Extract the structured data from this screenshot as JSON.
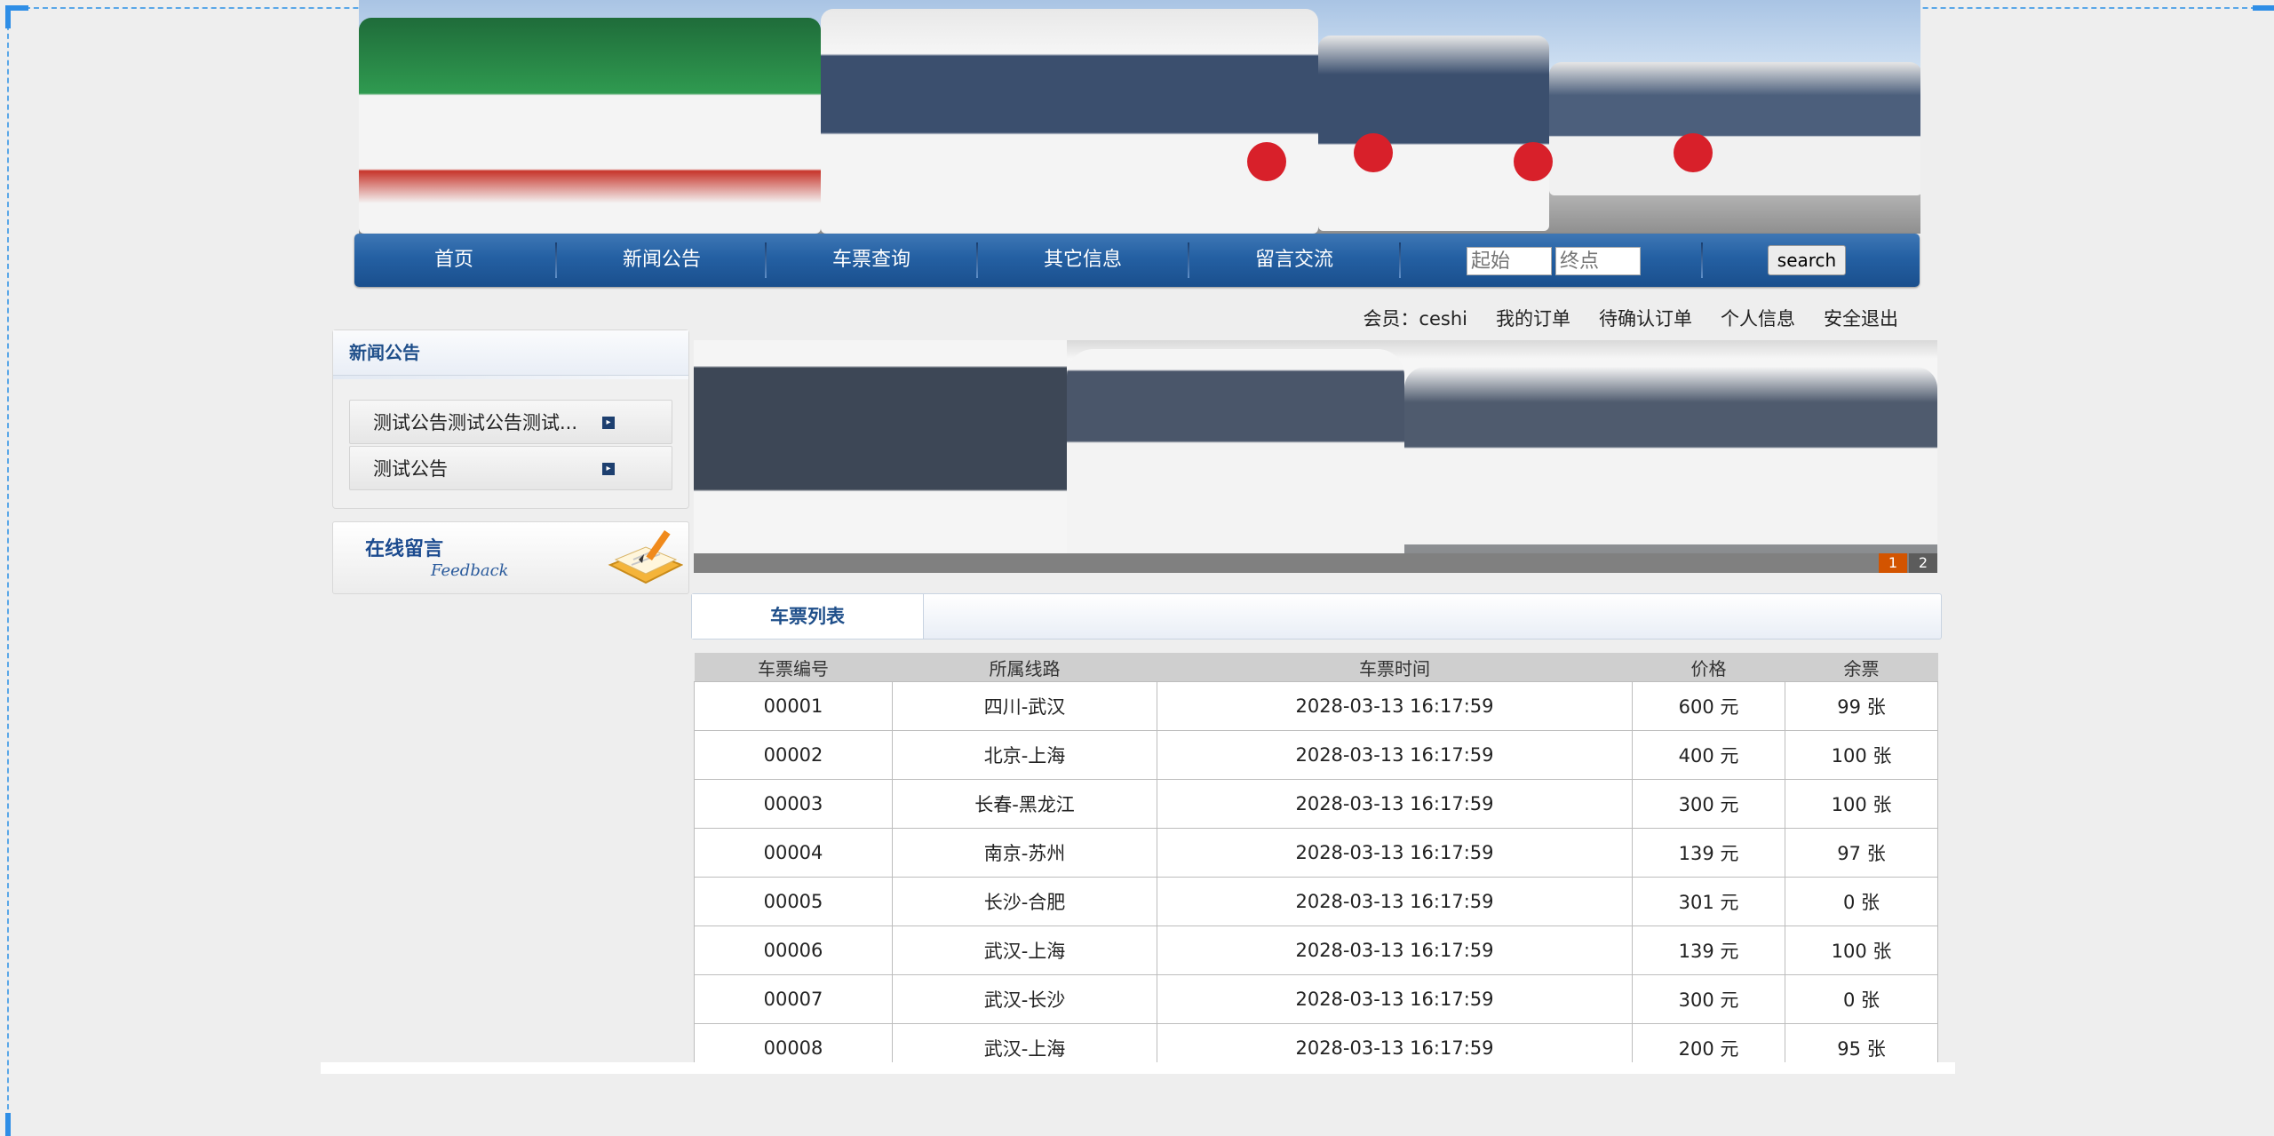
{
  "nav": {
    "items": [
      "首页",
      "新闻公告",
      "车票查询",
      "其它信息",
      "留言交流"
    ],
    "start_placeholder": "起始",
    "end_placeholder": "终点",
    "search_label": "search"
  },
  "member": {
    "label": "会员：ceshi",
    "links": [
      "我的订单",
      "待确认订单",
      "个人信息",
      "安全退出"
    ]
  },
  "news": {
    "title": "新闻公告",
    "items": [
      "测试公告测试公告测试...",
      "测试公告"
    ]
  },
  "feedback": {
    "title": "在线留言",
    "subtitle": "Feedback"
  },
  "slider": {
    "pages": [
      "1",
      "2"
    ],
    "active": "1"
  },
  "tickets": {
    "tab": "车票列表",
    "headers": [
      "车票编号",
      "所属线路",
      "车票时间",
      "价格",
      "余票"
    ],
    "rows": [
      [
        "00001",
        "四川-武汉",
        "2028-03-13 16:17:59",
        "600 元",
        "99 张"
      ],
      [
        "00002",
        "北京-上海",
        "2028-03-13 16:17:59",
        "400 元",
        "100 张"
      ],
      [
        "00003",
        "长春-黑龙江",
        "2028-03-13 16:17:59",
        "300 元",
        "100 张"
      ],
      [
        "00004",
        "南京-苏州",
        "2028-03-13 16:17:59",
        "139 元",
        "97 张"
      ],
      [
        "00005",
        "长沙-合肥",
        "2028-03-13 16:17:59",
        "301 元",
        "0 张"
      ],
      [
        "00006",
        "武汉-上海",
        "2028-03-13 16:17:59",
        "139 元",
        "100 张"
      ],
      [
        "00007",
        "武汉-长沙",
        "2028-03-13 16:17:59",
        "300 元",
        "0 张"
      ],
      [
        "00008",
        "武汉-上海",
        "2028-03-13 16:17:59",
        "200 元",
        "95 张"
      ]
    ]
  },
  "colors": {
    "nav_blue": "#2460a3",
    "accent_orange": "#d35400",
    "title_blue": "#1f4f8a"
  }
}
